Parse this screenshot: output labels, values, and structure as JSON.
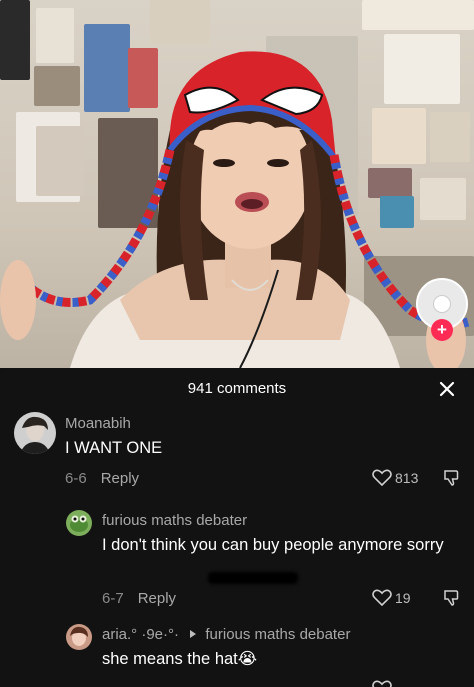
{
  "comments_sheet": {
    "title": "941 comments",
    "comments": [
      {
        "username": "Moanabih",
        "text": "I WANT ONE",
        "date": "6-6",
        "reply_label": "Reply",
        "likes": "813"
      },
      {
        "username": "furious maths debater",
        "text": "I don't think you can buy people anymore sorry",
        "date": "6-7",
        "reply_label": "Reply",
        "likes": "19"
      },
      {
        "username": "aria.° ·9e·°·",
        "reply_to": "furious maths debater",
        "text": "she means the hat",
        "emoji": "😭"
      }
    ]
  },
  "colors": {
    "sheet_background": "#121212",
    "follow_accent": "#fe2c55",
    "hat_red": "#d8232a",
    "hat_blue": "#3a5fc8"
  }
}
